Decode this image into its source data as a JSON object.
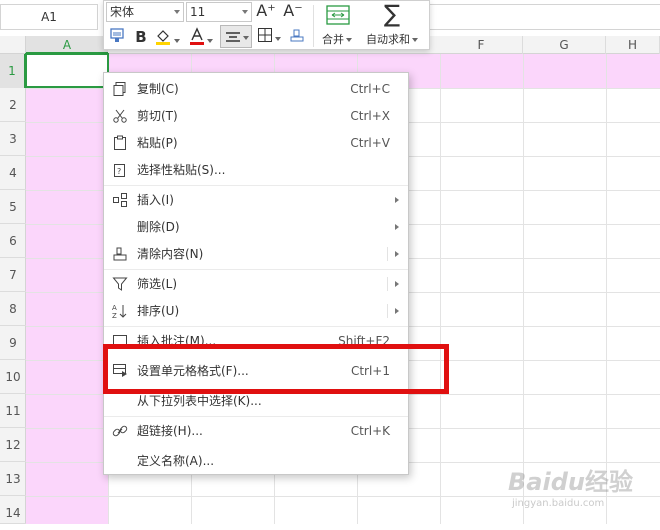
{
  "name_box": {
    "value": "A1"
  },
  "toolbar": {
    "font_name": "宋体",
    "font_size": "11",
    "merge_label": "合并",
    "autosum_label": "自动求和",
    "increase_font": "A⁺",
    "decrease_font": "A⁻",
    "bold": "B"
  },
  "columns": [
    "A",
    "F",
    "G",
    "H"
  ],
  "rows": [
    "1",
    "2",
    "3",
    "4",
    "5",
    "6",
    "7",
    "8",
    "9",
    "10",
    "11",
    "12",
    "13",
    "14"
  ],
  "menu": [
    {
      "label": "复制(C)",
      "shortcut": "Ctrl+C"
    },
    {
      "label": "剪切(T)",
      "shortcut": "Ctrl+X"
    },
    {
      "label": "粘贴(P)",
      "shortcut": "Ctrl+V"
    },
    {
      "label": "选择性粘贴(S)..."
    },
    {
      "label": "插入(I)"
    },
    {
      "label": "删除(D)"
    },
    {
      "label": "清除内容(N)"
    },
    {
      "label": "筛选(L)"
    },
    {
      "label": "排序(U)"
    },
    {
      "label": "插入批注(M)...",
      "shortcut": "Shift+F2"
    },
    {
      "label": "设置单元格格式(F)...",
      "shortcut": "Ctrl+1"
    },
    {
      "label": "从下拉列表中选择(K)..."
    },
    {
      "label": "超链接(H)...",
      "shortcut": "Ctrl+K"
    },
    {
      "label": "定义名称(A)..."
    }
  ],
  "watermark": {
    "brand": "Baidu",
    "tail": "经验",
    "url": "jingyan.baidu.com"
  },
  "colors": {
    "selection_fill": "#fbd6fb",
    "active_border": "#2a9a42",
    "highlight": "#e01010"
  }
}
